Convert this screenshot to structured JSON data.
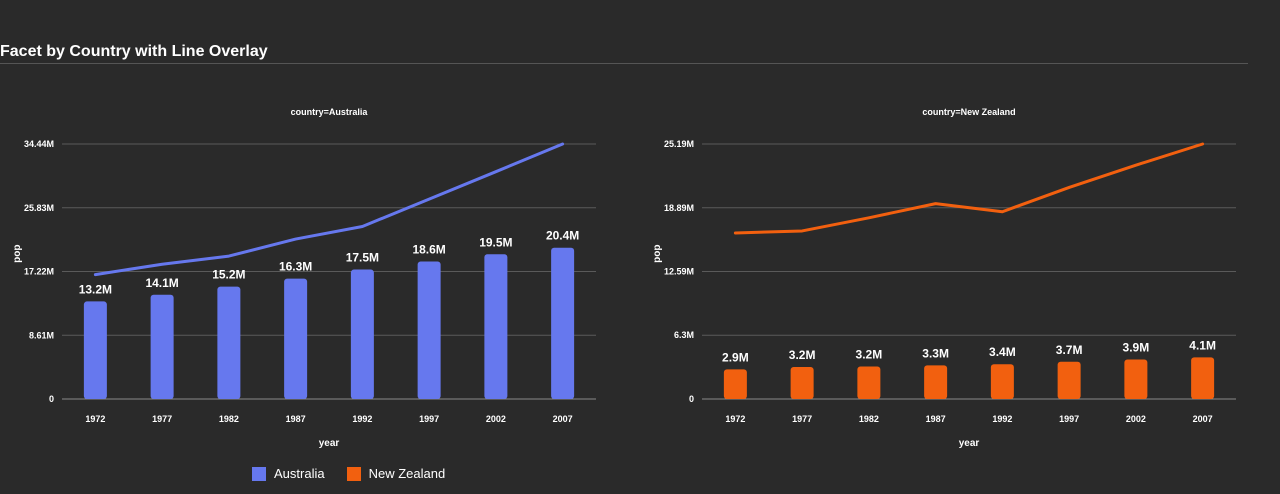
{
  "title": "Facet by Country with Line Overlay",
  "colors": {
    "background": "#2a2a2a",
    "grid": "#5a5a5a",
    "text": "#ffffff"
  },
  "legend": {
    "position": "bottom",
    "items": [
      {
        "label": "Australia",
        "color": "#6678ee"
      },
      {
        "label": "New Zealand",
        "color": "#f2600f"
      }
    ]
  },
  "chart_data": [
    {
      "type": "bar",
      "facet_title": "country=Australia",
      "xlabel": "year",
      "ylabel": "pop",
      "color": "#6678ee",
      "categories": [
        "1972",
        "1977",
        "1982",
        "1987",
        "1992",
        "1997",
        "2002",
        "2007"
      ],
      "bar_values": [
        13177000,
        14074100,
        15184200,
        16257249,
        17481977,
        18565243,
        19546792,
        20434176
      ],
      "bar_labels": [
        "13.2M",
        "14.1M",
        "15.2M",
        "16.3M",
        "17.5M",
        "18.6M",
        "19.5M",
        "20.4M"
      ],
      "line_values": [
        16800000,
        18200000,
        19300000,
        21600000,
        23300000,
        27000000,
        30700000,
        34440000
      ],
      "yticks": [
        0,
        8610000,
        17220000,
        25830000,
        34440000
      ],
      "ytick_labels": [
        "0",
        "8.61M",
        "17.22M",
        "25.83M",
        "34.44M"
      ],
      "ylim": [
        0,
        34440000
      ],
      "grid": true
    },
    {
      "type": "bar",
      "facet_title": "country=New Zealand",
      "xlabel": "year",
      "ylabel": "pop",
      "color": "#f2600f",
      "categories": [
        "1972",
        "1977",
        "1982",
        "1987",
        "1992",
        "1997",
        "2002",
        "2007"
      ],
      "bar_values": [
        2929100,
        3164900,
        3210650,
        3317166,
        3437674,
        3676187,
        3908037,
        4115771
      ],
      "bar_labels": [
        "2.9M",
        "3.2M",
        "3.2M",
        "3.3M",
        "3.4M",
        "3.7M",
        "3.9M",
        "4.1M"
      ],
      "line_values": [
        16400000,
        16600000,
        17900000,
        19300000,
        18500000,
        20900000,
        23100000,
        25190000
      ],
      "yticks": [
        0,
        6300000,
        12590000,
        18890000,
        25190000
      ],
      "ytick_labels": [
        "0",
        "6.3M",
        "12.59M",
        "18.89M",
        "25.19M"
      ],
      "ylim": [
        0,
        25190000
      ],
      "grid": true
    }
  ]
}
